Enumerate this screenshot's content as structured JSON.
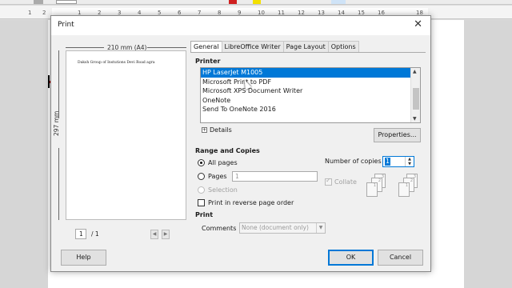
{
  "background": {
    "ruler_ticks": [
      "1",
      "2",
      "1",
      "2",
      "3",
      "4",
      "5",
      "6",
      "7",
      "8",
      "9",
      "10",
      "11",
      "12",
      "13",
      "14",
      "15",
      "16",
      "18"
    ]
  },
  "dialog": {
    "title": "Print",
    "tabs": [
      {
        "label": "General",
        "active": true
      },
      {
        "label": "LibreOffice Writer",
        "active": false
      },
      {
        "label": "Page Layout",
        "active": false
      },
      {
        "label": "Options",
        "active": false
      }
    ],
    "preview": {
      "width_label": "210 mm (A4)",
      "height_label": "297 mm",
      "page_text": "Daksh Group of Instutions Devi Road agra",
      "page_number": "1",
      "page_total": "/ 1"
    },
    "printer": {
      "section_label": "Printer",
      "items": [
        "HP LaserJet M1005",
        "Microsoft Print to PDF",
        "Microsoft XPS Document Writer",
        "OneNote",
        "Send To OneNote 2016"
      ],
      "selected_index": 0,
      "details_label": "Details",
      "properties_button": "Properties..."
    },
    "range": {
      "section_label": "Range and Copies",
      "all_pages_label": "All pages",
      "pages_label": "Pages",
      "pages_value": "1",
      "selection_label": "Selection",
      "reverse_label": "Print in reverse page order",
      "copies_label": "Number of copies",
      "copies_value": "1",
      "collate_label": "Collate",
      "selected_option": "all_pages"
    },
    "print_section": {
      "section_label": "Print",
      "comments_label": "Comments",
      "comments_value": "None (document only)"
    },
    "buttons": {
      "help": "Help",
      "ok": "OK",
      "cancel": "Cancel"
    }
  }
}
